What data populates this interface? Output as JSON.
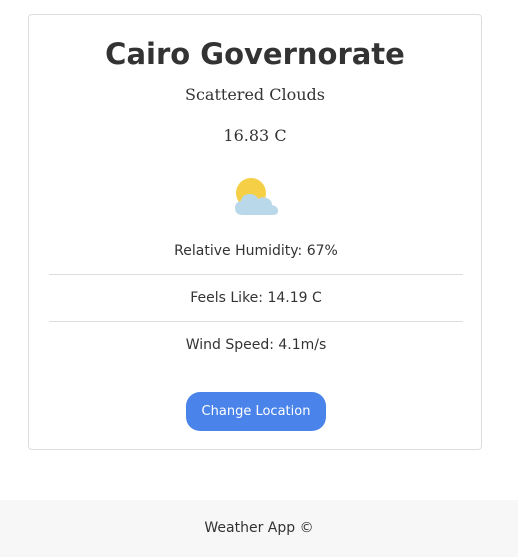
{
  "weather": {
    "city": "Cairo Governorate",
    "description": "Scattered Clouds",
    "temperature": "16.83 C",
    "icon": "partly-cloudy-icon",
    "humidity": "Relative Humidity: 67%",
    "feels_like": "Feels Like: 14.19 C",
    "wind_speed": "Wind Speed: 4.1m/s"
  },
  "actions": {
    "change_location_label": "Change Location"
  },
  "footer": {
    "text": "Weather App ©"
  },
  "colors": {
    "accent": "#4a84ea",
    "sun": "#f5cf45",
    "cloud": "#b9d9ea",
    "border": "#dddddd",
    "footer_bg": "#f7f7f8"
  }
}
